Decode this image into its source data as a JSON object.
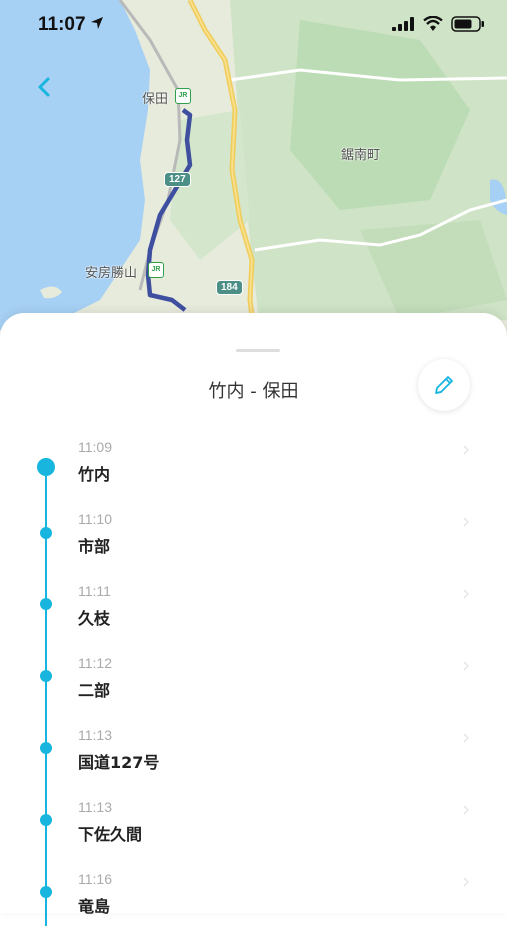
{
  "status_bar": {
    "time": "11:07"
  },
  "map": {
    "labels": {
      "hota": "保田",
      "awakatsuyama": "安房勝山",
      "kyonan": "鋸南町"
    },
    "shields": {
      "route127": "127",
      "route184": "184"
    },
    "jr_mark": "JR"
  },
  "route": {
    "title": "竹内 - 保田"
  },
  "stops": [
    {
      "time": "11:09",
      "name": "竹内"
    },
    {
      "time": "11:10",
      "name": "市部"
    },
    {
      "time": "11:11",
      "name": "久枝"
    },
    {
      "time": "11:12",
      "name": "二部"
    },
    {
      "time": "11:13",
      "name": "国道127号"
    },
    {
      "time": "11:13",
      "name": "下佐久間"
    },
    {
      "time": "11:16",
      "name": "竜島"
    }
  ],
  "colors": {
    "accent": "#18b6df",
    "sea": "#a6d0f4",
    "route_line": "#3f4fa0"
  },
  "icons": {
    "back": "back-chevron-icon",
    "edit": "pencil-icon",
    "row": "chevron-right-icon"
  }
}
